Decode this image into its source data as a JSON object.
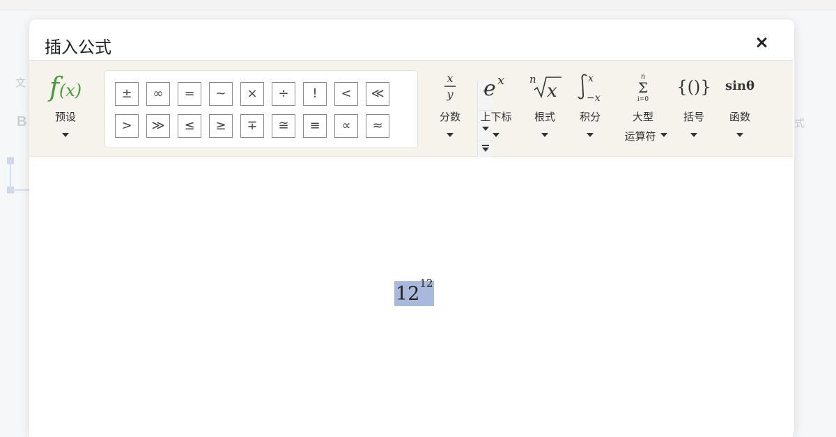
{
  "background": {
    "left_text": "文",
    "left_bold": "B",
    "right_text": "式"
  },
  "dialog": {
    "title": "插入公式",
    "close_icon": "close-icon"
  },
  "toolbar": {
    "preset": {
      "glyph": "f(x)",
      "label": "预设"
    },
    "symbols_row1": [
      "±",
      "∞",
      "=",
      "~",
      "×",
      "÷",
      "!",
      "<",
      "≪"
    ],
    "symbols_row2": [
      ">",
      "≫",
      "≤",
      "≥",
      "∓",
      "≅",
      "≡",
      "∝",
      "≈"
    ],
    "tools": [
      {
        "id": "fraction",
        "label": "分数"
      },
      {
        "id": "script",
        "label": "上下标"
      },
      {
        "id": "radical",
        "label": "根式"
      },
      {
        "id": "integral",
        "label": "积分"
      },
      {
        "id": "large-operator",
        "label": "大型",
        "label2": "运算符"
      },
      {
        "id": "bracket",
        "label": "括号"
      },
      {
        "id": "function",
        "label": "函数"
      }
    ]
  },
  "editor": {
    "base": "12",
    "superscript": "12"
  }
}
